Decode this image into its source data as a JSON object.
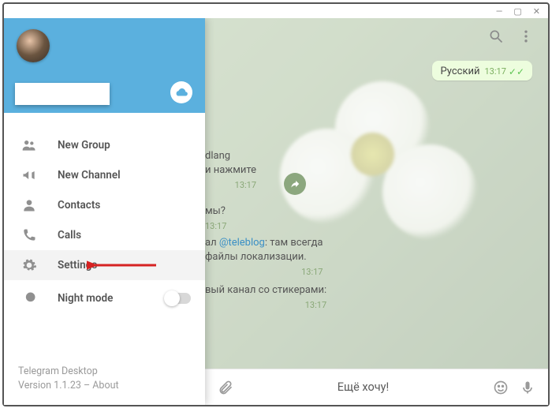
{
  "titlebar": {
    "min": "—",
    "max": "▢",
    "close": "✕"
  },
  "sidebar": {
    "items": [
      {
        "label": "New Group"
      },
      {
        "label": "New Channel"
      },
      {
        "label": "Contacts"
      },
      {
        "label": "Calls"
      },
      {
        "label": "Settings"
      },
      {
        "label": "Night mode"
      }
    ]
  },
  "footer": {
    "app": "Telegram Desktop",
    "version_prefix": "Version 1.1.23 – ",
    "about": "About"
  },
  "chat": {
    "bubble_russian": "Русский",
    "bubble_russian_time": "13:17",
    "frag1_l1": "dlang",
    "frag1_l2": "и нажмите",
    "frag1_time": "13:17",
    "frag2": "мы?",
    "frag2_time": "13:17",
    "frag3_l1_a": "ал ",
    "frag3_link": "@teleblog",
    "frag3_l1_b": ": там всегда",
    "frag3_l2": "файлы локализации.",
    "frag3_time": "13:17",
    "frag4": "вый канал со стикерами:",
    "frag4_time": "13:17",
    "input_placeholder": "Ещё хочу!"
  }
}
